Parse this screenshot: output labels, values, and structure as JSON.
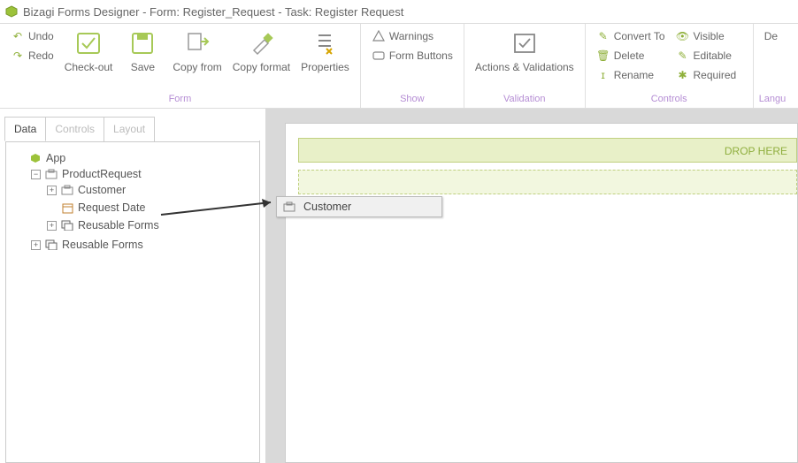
{
  "title": "Bizagi Forms Designer  - Form: Register_Request - Task:  Register Request",
  "ribbon": {
    "undo": "Undo",
    "redo": "Redo",
    "checkout": "Check-out",
    "save": "Save",
    "copyfrom": "Copy from",
    "copyformat": "Copy format",
    "properties": "Properties",
    "warnings": "Warnings",
    "formbuttons": "Form Buttons",
    "actions": "Actions & Validations",
    "convert": "Convert To",
    "delete": "Delete",
    "rename": "Rename",
    "visible": "Visible",
    "editable": "Editable",
    "required": "Required",
    "default_partial": "De",
    "groups": {
      "form": "Form",
      "show": "Show",
      "validation": "Validation",
      "controls": "Controls",
      "lang": "Langu"
    }
  },
  "tabs": {
    "data": "Data",
    "controls": "Controls",
    "layout": "Layout"
  },
  "tree": {
    "app": "App",
    "productrequest": "ProductRequest",
    "customer": "Customer",
    "requestdate": "Request Date",
    "reusable1": "Reusable Forms",
    "reusable2": "Reusable Forms"
  },
  "canvas": {
    "drophere": "DROP HERE"
  },
  "drag": {
    "customer": "Customer"
  }
}
